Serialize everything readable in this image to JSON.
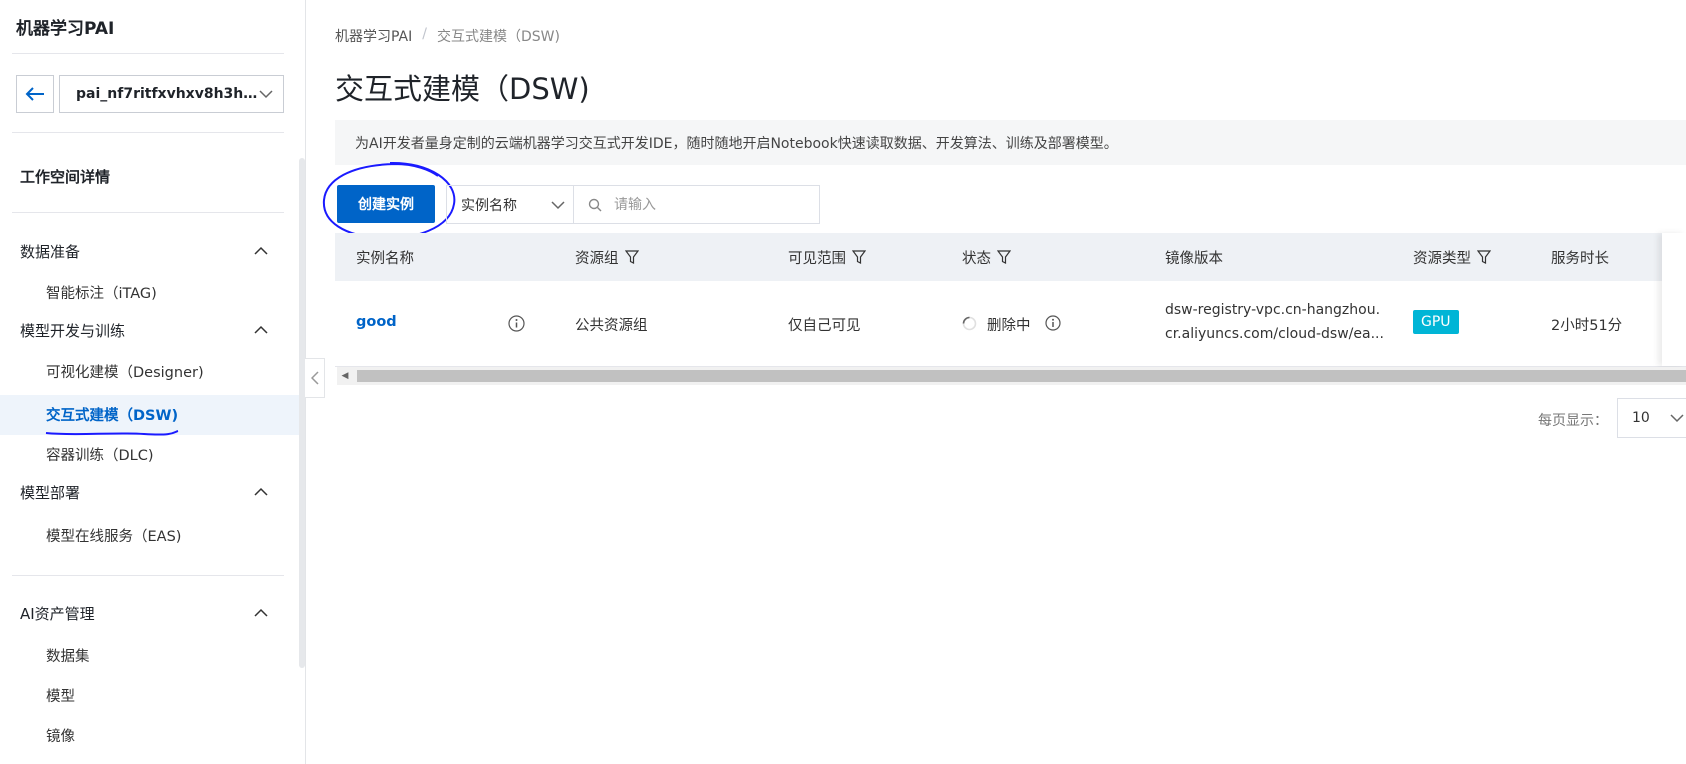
{
  "app": {
    "title": "机器学习PAI"
  },
  "workspace": {
    "name": "pai_nf7ritfxvhxv8h3h..."
  },
  "sidebar": {
    "top_link": "工作空间详情",
    "groups": [
      {
        "label": "数据准备",
        "items": [
          {
            "label": "智能标注（iTAG)"
          }
        ]
      },
      {
        "label": "模型开发与训练",
        "items": [
          {
            "label": "可视化建模（Designer)"
          },
          {
            "label": "交互式建模（DSW)"
          },
          {
            "label": "容器训练（DLC)"
          }
        ]
      },
      {
        "label": "模型部署",
        "items": [
          {
            "label": "模型在线服务（EAS)"
          }
        ]
      },
      {
        "label": "AI资产管理",
        "items": [
          {
            "label": "数据集"
          },
          {
            "label": "模型"
          },
          {
            "label": "镜像"
          }
        ]
      }
    ],
    "active_item": "交互式建模（DSW)"
  },
  "breadcrumb": {
    "root": "机器学习PAI",
    "sep": "/",
    "current": "交互式建模（DSW)"
  },
  "page": {
    "title": "交互式建模（DSW)",
    "description": "为AI开发者量身定制的云端机器学习交互式开发IDE，随时随地开启Notebook快速读取数据、开发算法、训练及部署模型。"
  },
  "toolbar": {
    "create_label": "创建实例",
    "filter_field": "实例名称",
    "search_placeholder": "请输入"
  },
  "table": {
    "columns": {
      "name": "实例名称",
      "group": "资源组",
      "visibility": "可见范围",
      "status": "状态",
      "image": "镜像版本",
      "resource_type": "资源类型",
      "duration": "服务时长"
    },
    "rows": [
      {
        "name": "good",
        "group": "公共资源组",
        "visibility": "仅自己可见",
        "status": "删除中",
        "image_line1": "dsw-registry-vpc.cn-hangzhou.",
        "image_line2": "cr.aliyuncs.com/cloud-dsw/ea...",
        "resource_type": "GPU",
        "duration": "2小时51分"
      }
    ]
  },
  "pagination": {
    "page_size_label": "每页显示：",
    "page_size": "10"
  },
  "colors": {
    "primary": "#0064c8",
    "gpu_badge": "#00b5d6",
    "annotation": "#1a1aff"
  },
  "icons": [
    "back-arrow-icon",
    "chevron-down-icon",
    "chevron-up-icon",
    "search-icon",
    "filter-funnel-icon",
    "info-icon",
    "loading-spinner-icon",
    "chevron-left-icon"
  ]
}
